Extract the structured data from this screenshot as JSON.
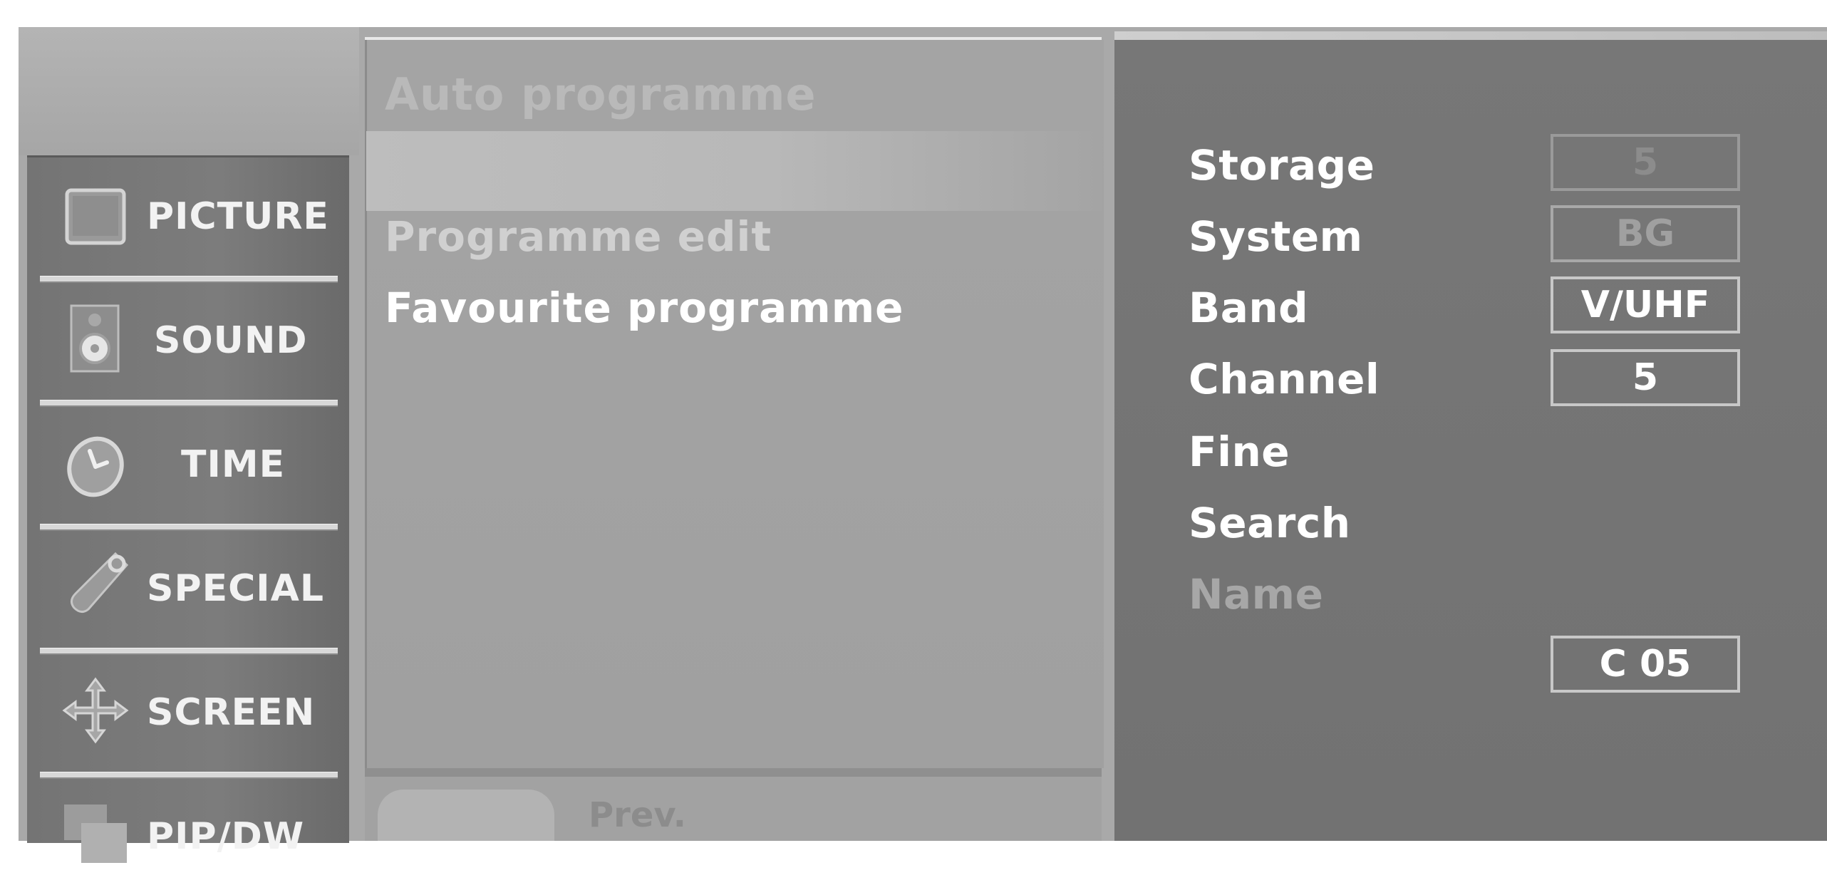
{
  "categories": [
    {
      "label": "PICTURE",
      "icon": "picture-icon"
    },
    {
      "label": "SOUND",
      "icon": "speaker-icon"
    },
    {
      "label": "TIME",
      "icon": "clock-icon"
    },
    {
      "label": "SPECIAL",
      "icon": "tag-icon"
    },
    {
      "label": "SCREEN",
      "icon": "move-arrows-icon"
    },
    {
      "label": "PIP/DW",
      "icon": "pip-icon"
    }
  ],
  "programme_menu": {
    "title": "Auto programme",
    "items": [
      {
        "label": "Programme edit"
      },
      {
        "label": "Favourite programme"
      }
    ],
    "footer": {
      "prev_label": "Prev."
    }
  },
  "settings": {
    "labels": {
      "storage": "Storage",
      "system": "System",
      "band": "Band",
      "channel": "Channel",
      "fine": "Fine",
      "search": "Search",
      "name": "Name"
    },
    "values": {
      "storage": "5",
      "system": "BG",
      "band": "V/UHF",
      "channel": "5",
      "name": "C 05"
    }
  },
  "colors": {
    "menu_background": "#a9a9a9",
    "category_panel": "#747474",
    "settings_panel": "#777777",
    "text_active": "#ffffff",
    "text_dim": "#a7a7a7"
  }
}
